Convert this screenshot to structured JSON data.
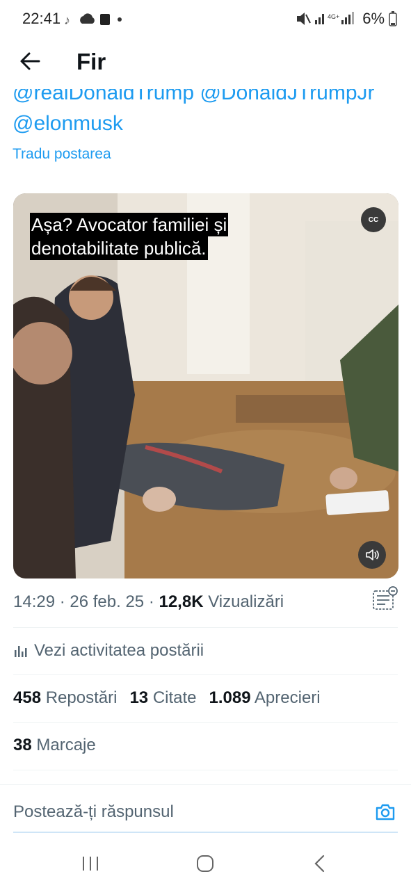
{
  "status_bar": {
    "time": "22:41",
    "battery": "6%"
  },
  "header": {
    "title": "Fir"
  },
  "post": {
    "mentions_line1": "@realDonaldTrump @DonaldJTrumpJr",
    "mentions_line2": "@elonmusk",
    "translate_label": "Tradu postarea",
    "video_subtitle": "Așa? Avocator familiei și denotabilitate publică.",
    "cc_label": "CC",
    "timestamp": "14:29 · 26 feb. 25 · ",
    "views_count": "12,8K",
    "views_label": " Vizualizări",
    "activity_label": "Vezi activitatea postării",
    "reposts_count": "458",
    "reposts_label": "Repostări",
    "quotes_count": "13",
    "quotes_label": "Citate",
    "likes_count": "1.089",
    "likes_label": "Aprecieri",
    "bookmarks_count": "38",
    "bookmarks_label": "Marcaje"
  },
  "reply": {
    "placeholder": "Postează-ți răspunsul"
  },
  "colors": {
    "accent": "#1d9bf0",
    "secondary_text": "#536471"
  }
}
